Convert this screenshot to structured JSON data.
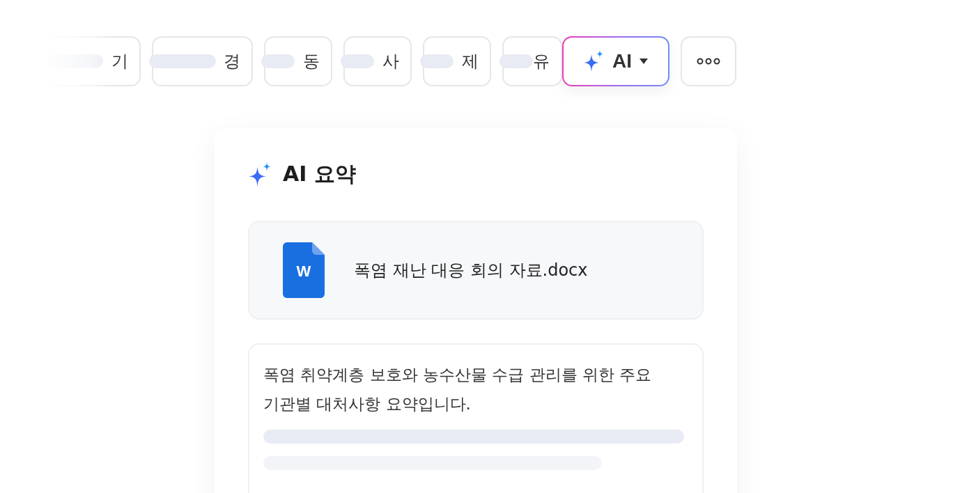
{
  "toolbar": {
    "chips": [
      {
        "label": "기"
      },
      {
        "label": "경"
      },
      {
        "label": "동"
      },
      {
        "label": "사"
      },
      {
        "label": "제"
      },
      {
        "label": "유"
      }
    ],
    "ai_button": {
      "label": "AI"
    }
  },
  "summary_card": {
    "title": "AI 요약",
    "file": {
      "name": "폭염 재난 대응 회의 자료.docx",
      "icon_letter": "W"
    },
    "summary_text": "폭염 취약계층 보호와 농수산물 수급 관리를 위한 주요 기관별 대처사항 요약입니다."
  }
}
